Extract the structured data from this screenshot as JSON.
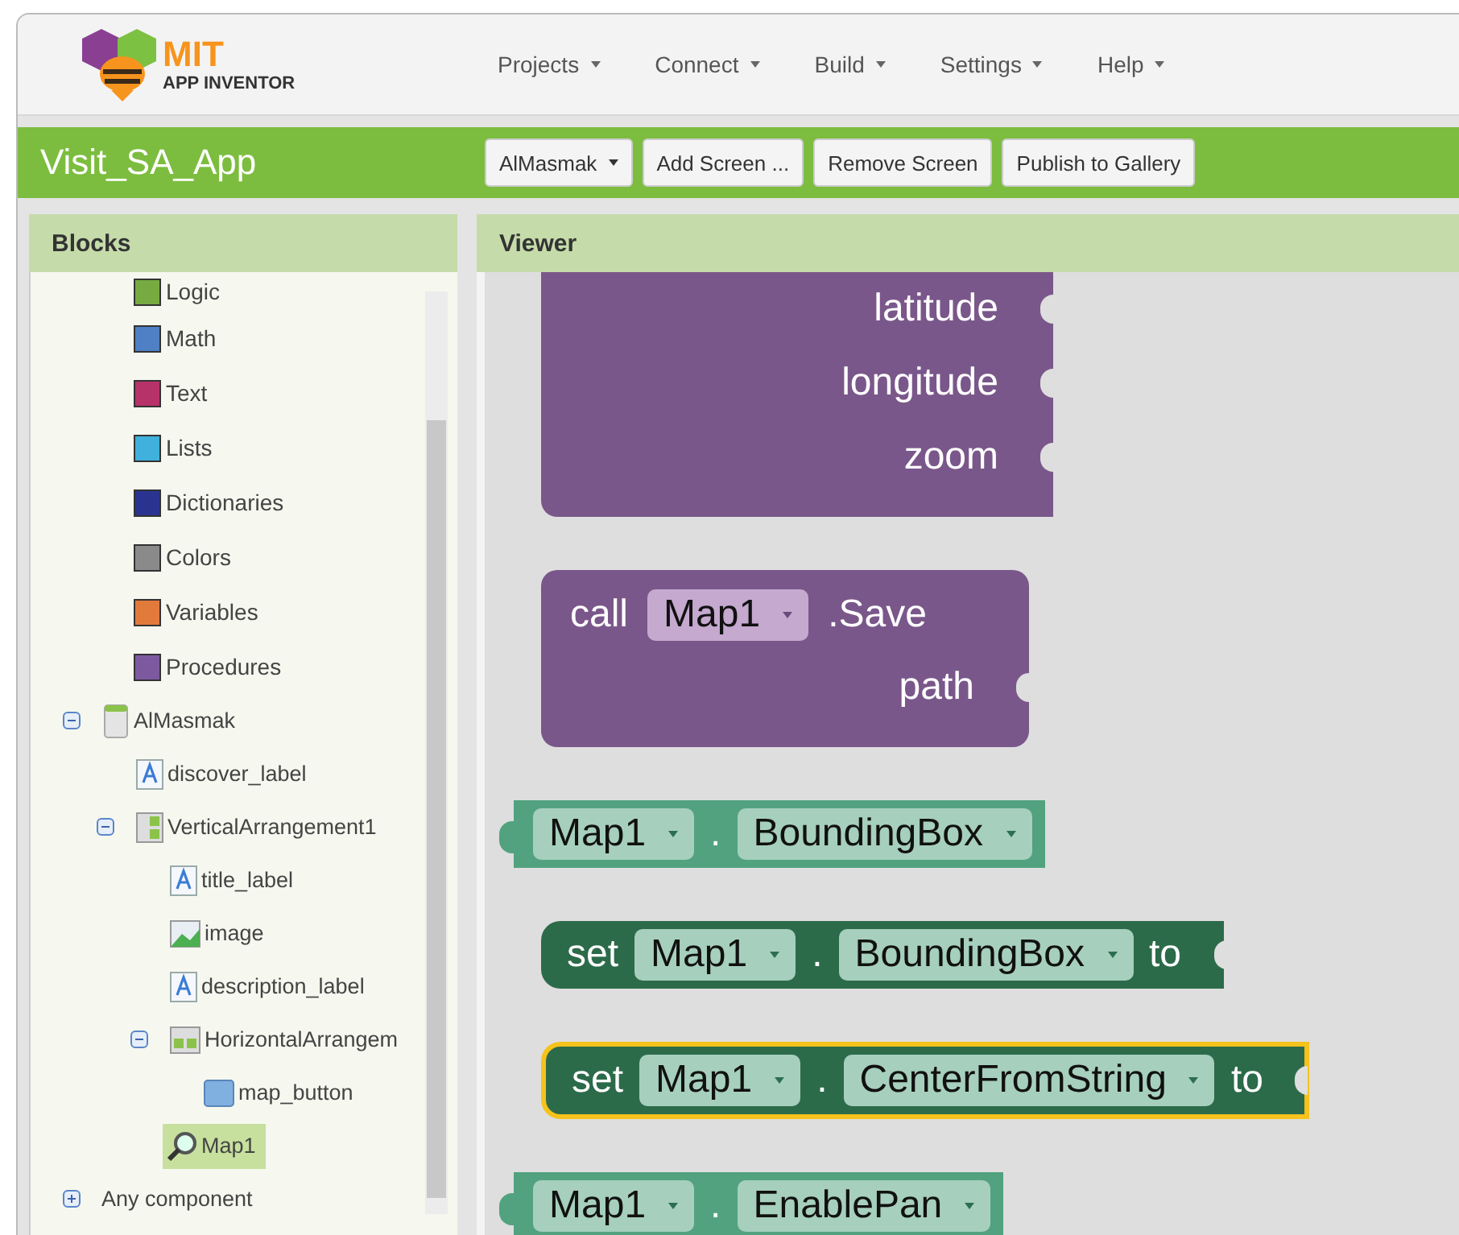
{
  "logo": {
    "title": "MIT",
    "subtitle": "APP INVENTOR"
  },
  "menu": [
    {
      "label": "Projects"
    },
    {
      "label": "Connect"
    },
    {
      "label": "Build"
    },
    {
      "label": "Settings"
    },
    {
      "label": "Help"
    }
  ],
  "project": {
    "title": "Visit_SA_App",
    "screen_dropdown": "AlMasmak",
    "buttons": [
      "Add Screen ...",
      "Remove Screen",
      "Publish to Gallery"
    ]
  },
  "blocks_panel": {
    "title": "Blocks",
    "builtin": [
      {
        "label": "Logic",
        "color": "#77ab41"
      },
      {
        "label": "Math",
        "color": "#4f7fc4"
      },
      {
        "label": "Text",
        "color": "#b8326a"
      },
      {
        "label": "Lists",
        "color": "#3fb1dc"
      },
      {
        "label": "Dictionaries",
        "color": "#2a3490"
      },
      {
        "label": "Colors",
        "color": "#8a8a8a"
      },
      {
        "label": "Variables",
        "color": "#e27a3c"
      },
      {
        "label": "Procedures",
        "color": "#7d5aa0"
      }
    ],
    "components": [
      {
        "label": "AlMasmak",
        "kind": "screen",
        "expanded": true,
        "selected": false,
        "children": [
          {
            "label": "discover_label",
            "kind": "label",
            "selected": false
          },
          {
            "label": "VerticalArrangement1",
            "kind": "vertical",
            "expanded": true,
            "selected": false,
            "children": [
              {
                "label": "title_label",
                "kind": "label",
                "selected": false
              },
              {
                "label": "image",
                "kind": "image",
                "selected": false
              },
              {
                "label": "description_label",
                "kind": "label",
                "selected": false
              },
              {
                "label": "HorizontalArrangem",
                "kind": "horizontal",
                "expanded": true,
                "selected": false,
                "children": [
                  {
                    "label": "map_button",
                    "kind": "button",
                    "selected": false
                  }
                ]
              },
              {
                "label": "Map1",
                "kind": "map",
                "selected": true
              }
            ]
          }
        ]
      }
    ],
    "any_component": {
      "label": "Any component",
      "expanded": false
    }
  },
  "viewer": {
    "title": "Viewer",
    "blocks": [
      {
        "kind": "method",
        "selected": false,
        "args": [
          "latitude",
          "longitude",
          "zoom"
        ]
      },
      {
        "kind": "method",
        "selected": false,
        "keyword": "call",
        "component": "Map1",
        "member": ".Save",
        "args": [
          "path"
        ]
      },
      {
        "kind": "getter",
        "selected": false,
        "component": "Map1",
        "separator": ".",
        "property": "BoundingBox"
      },
      {
        "kind": "setter",
        "selected": false,
        "keyword": "set",
        "component": "Map1",
        "separator": ".",
        "property": "BoundingBox",
        "suffix": "to"
      },
      {
        "kind": "setter",
        "selected": true,
        "keyword": "set",
        "component": "Map1",
        "separator": ".",
        "property": "CenterFromString",
        "suffix": "to"
      },
      {
        "kind": "getter",
        "selected": false,
        "component": "Map1",
        "separator": ".",
        "property": "EnablePan"
      }
    ]
  }
}
